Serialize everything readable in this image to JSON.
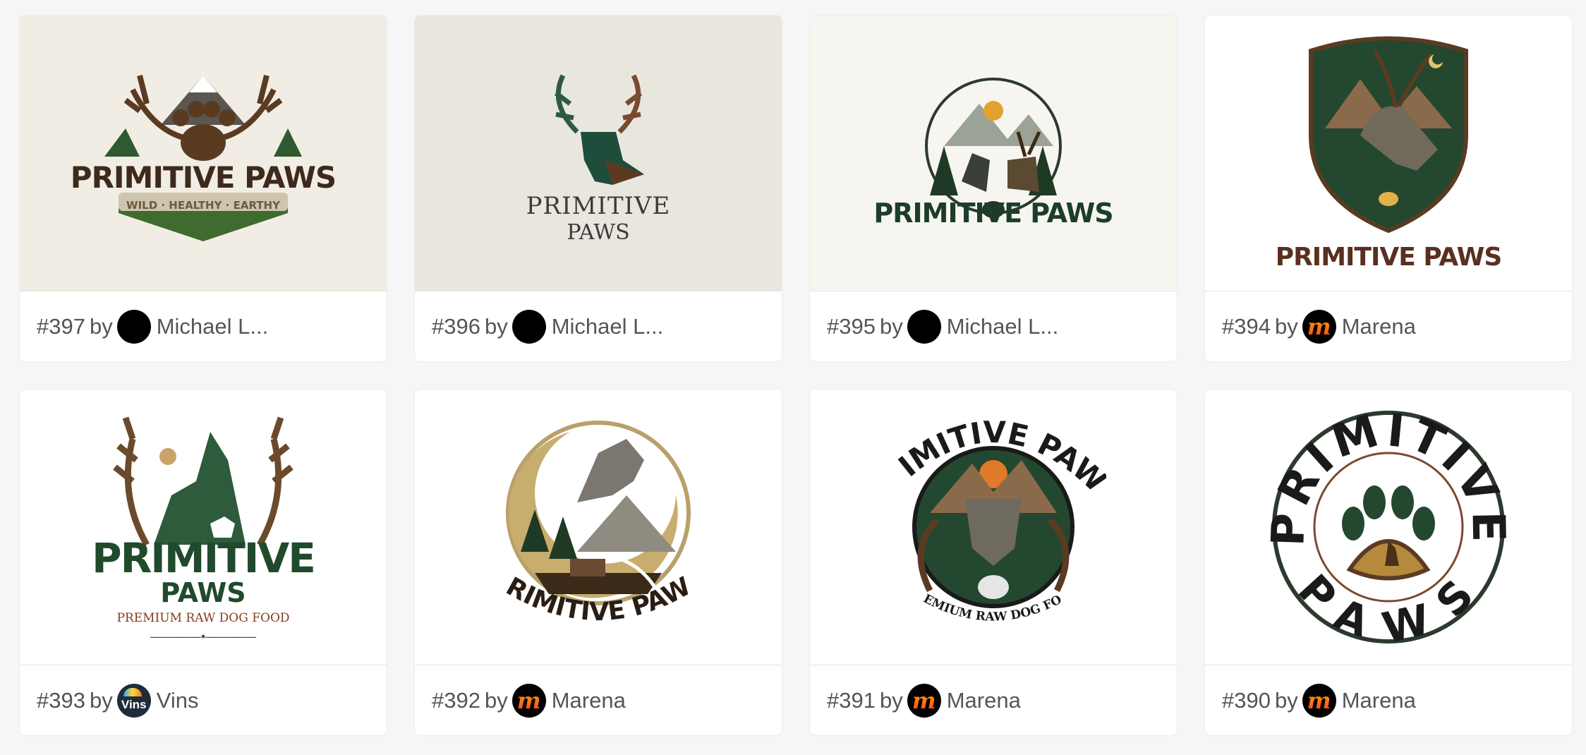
{
  "entries": [
    {
      "number": "#397",
      "by": "by",
      "author": "Michael L...",
      "avatar_type": "dark",
      "logo": {
        "title": "PRIMITIVE PAWS",
        "tagline": "WILD · HEALTHY · EARTHY"
      },
      "background": "#f1ede5"
    },
    {
      "number": "#396",
      "by": "by",
      "author": "Michael L...",
      "avatar_type": "dark",
      "logo": {
        "title_line1": "PRIMITIVE",
        "title_line2": "PAWS"
      },
      "background": "#e9e6de"
    },
    {
      "number": "#395",
      "by": "by",
      "author": "Michael L...",
      "avatar_type": "dark",
      "logo": {
        "title": "PRIMITIVE PAWS"
      },
      "background": "#f6f5f0"
    },
    {
      "number": "#394",
      "by": "by",
      "author": "Marena",
      "avatar_type": "marena",
      "avatar_letter": "m",
      "logo": {
        "title": "PRIMITIVE PAWS"
      },
      "background": "#ffffff"
    },
    {
      "number": "#393",
      "by": "by",
      "author": "Vins",
      "avatar_type": "vins",
      "avatar_text": "Vins",
      "logo": {
        "title_line1": "PRIMITIVE",
        "title_line2": "PAWS",
        "tagline": "PREMIUM RAW DOG FOOD"
      },
      "background": "#ffffff"
    },
    {
      "number": "#392",
      "by": "by",
      "author": "Marena",
      "avatar_type": "marena",
      "avatar_letter": "m",
      "logo": {
        "title": "PRIMITIVE PAWS"
      },
      "background": "#ffffff"
    },
    {
      "number": "#391",
      "by": "by",
      "author": "Marena",
      "avatar_type": "marena",
      "avatar_letter": "m",
      "logo": {
        "title": "PRIMITIVE PAWS",
        "tagline": "PREMIUM RAW DOG FOOD"
      },
      "background": "#ffffff"
    },
    {
      "number": "#390",
      "by": "by",
      "author": "Marena",
      "avatar_type": "marena",
      "avatar_letter": "m",
      "logo": {
        "title_line1": "PRIMITIVE",
        "title_line2": "PAWS"
      },
      "background": "#ffffff"
    }
  ],
  "colors": {
    "forest": "#24472f",
    "brown": "#5a3b22",
    "cream": "#f1ede5",
    "text": "#555555"
  }
}
